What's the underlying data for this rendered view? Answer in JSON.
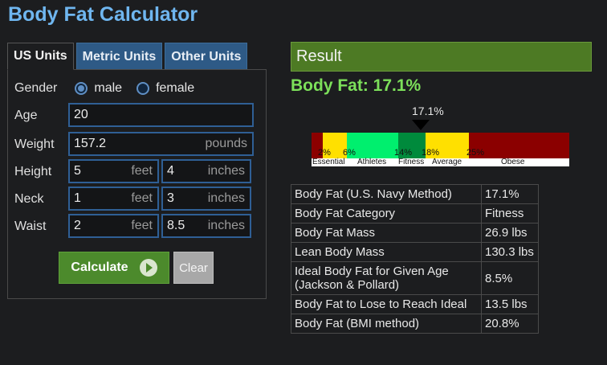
{
  "title": "Body Fat Calculator",
  "tabs": [
    {
      "label": "US Units",
      "active": true
    },
    {
      "label": "Metric Units",
      "active": false
    },
    {
      "label": "Other Units",
      "active": false
    }
  ],
  "form": {
    "gender": {
      "label": "Gender",
      "options": [
        "male",
        "female"
      ],
      "selected": "male"
    },
    "age": {
      "label": "Age",
      "value": "20"
    },
    "weight": {
      "label": "Weight",
      "value": "157.2",
      "unit": "pounds"
    },
    "height": {
      "label": "Height",
      "feet": "5",
      "feet_unit": "feet",
      "inches": "4",
      "inches_unit": "inches"
    },
    "neck": {
      "label": "Neck",
      "feet": "1",
      "feet_unit": "feet",
      "inches": "3",
      "inches_unit": "inches"
    },
    "waist": {
      "label": "Waist",
      "feet": "2",
      "feet_unit": "feet",
      "inches": "8.5",
      "inches_unit": "inches"
    },
    "calculate_label": "Calculate",
    "clear_label": "Clear"
  },
  "result": {
    "header": "Result",
    "body_fat_line": "Body Fat: 17.1%",
    "marker_label": "17.1%",
    "scale": {
      "ticks": [
        "2%",
        "6%",
        "14%",
        "18%",
        "25%"
      ],
      "categories": [
        "Essential",
        "Athletes",
        "Fitness",
        "Average",
        "Obese"
      ],
      "colors": {
        "dark_red": "#8b0000",
        "yellow": "#ffe000",
        "light_green": "#00ef6e",
        "dark_green": "#008a3c"
      }
    },
    "table": [
      {
        "key": "Body Fat (U.S. Navy Method)",
        "value": "17.1%"
      },
      {
        "key": "Body Fat Category",
        "value": "Fitness"
      },
      {
        "key": "Body Fat Mass",
        "value": "26.9 lbs"
      },
      {
        "key": "Lean Body Mass",
        "value": "130.3 lbs"
      },
      {
        "key": "Ideal Body Fat for Given Age (Jackson & Pollard)",
        "value": "8.5%"
      },
      {
        "key": "Body Fat to Lose to Reach Ideal",
        "value": "13.5 lbs"
      },
      {
        "key": "Body Fat (BMI method)",
        "value": "20.8%"
      }
    ]
  },
  "colors": {
    "title_blue": "#6fb6ef",
    "tab_blue": "#2e5a86",
    "result_green": "#4d7a24",
    "bodyfat_green": "#7ce05a",
    "button_green": "#4c8a2c"
  }
}
